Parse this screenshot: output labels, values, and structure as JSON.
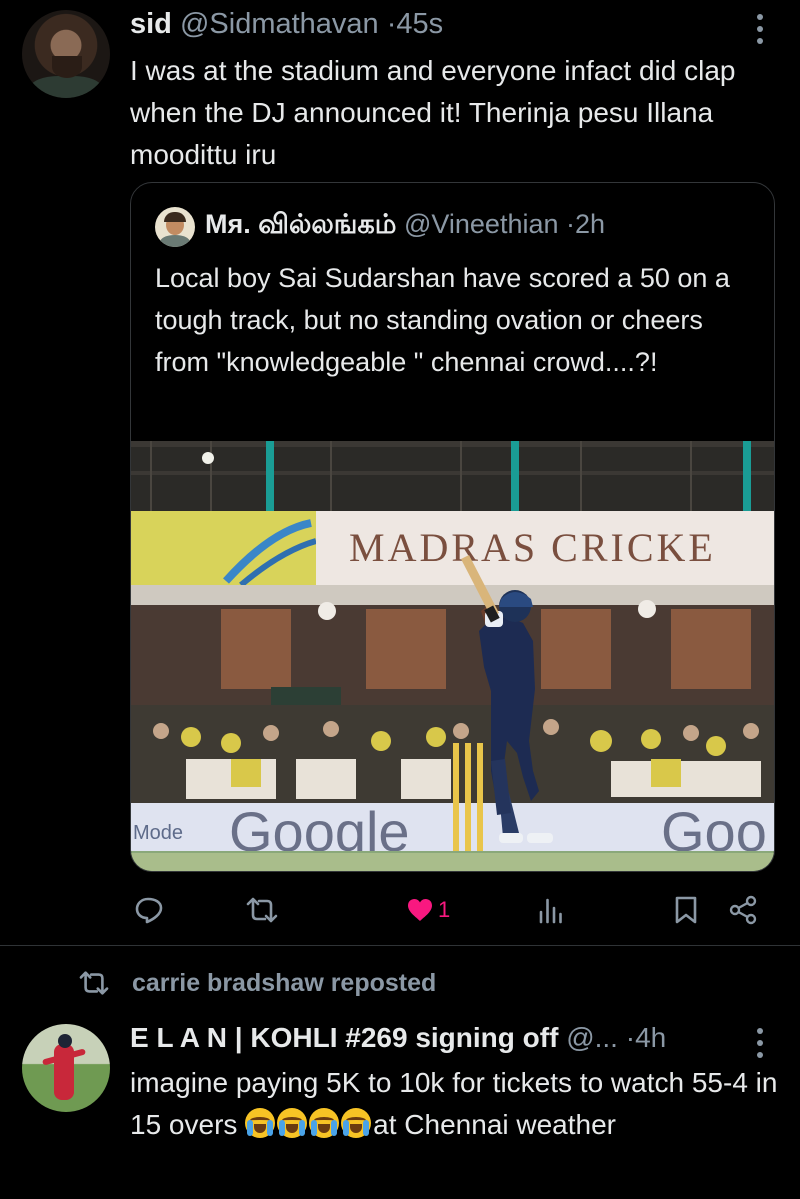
{
  "tweet_main": {
    "name": "sid",
    "handle": "@Sidmathavan",
    "separator": "·",
    "time": "45s",
    "text": "I was at the stadium and everyone infact did clap when the DJ announced it! Therinja pesu Illana moodittu iru"
  },
  "quoted_tweet": {
    "name": "Мя. வில்லங்கம்",
    "handle": "@Vineethian",
    "separator": "·",
    "time": "2h",
    "text": "Local boy Sai Sudarshan have scored a 50 on a tough track, but no standing ovation or cheers from \"knowledgeable \" chennai crowd....?!",
    "image": {
      "banner_text": "MADRAS CRICKE",
      "board_text": "Google",
      "board_left_text": "Mode"
    }
  },
  "actions": {
    "like_count": "1",
    "icons": [
      "reply-icon",
      "retweet-icon",
      "like-icon",
      "analytics-icon",
      "bookmark-icon",
      "share-icon"
    ],
    "like_color": "#f91880"
  },
  "repost_banner": {
    "label": "carrie bradshaw reposted"
  },
  "tweet_second": {
    "name": "E L A N | KOHLI #269 signing off",
    "handle": "@...",
    "separator": "·",
    "time": "4h",
    "text_before_emoji": "imagine paying 5K to 10k for tickets to watch 55-4 in 15 overs ",
    "emoji_count": 4,
    "text_after_emoji": "at Chennai weather"
  },
  "colors": {
    "background": "#000000",
    "text": "#e7e9ea",
    "muted": "#8b98a5",
    "border": "#333639"
  }
}
